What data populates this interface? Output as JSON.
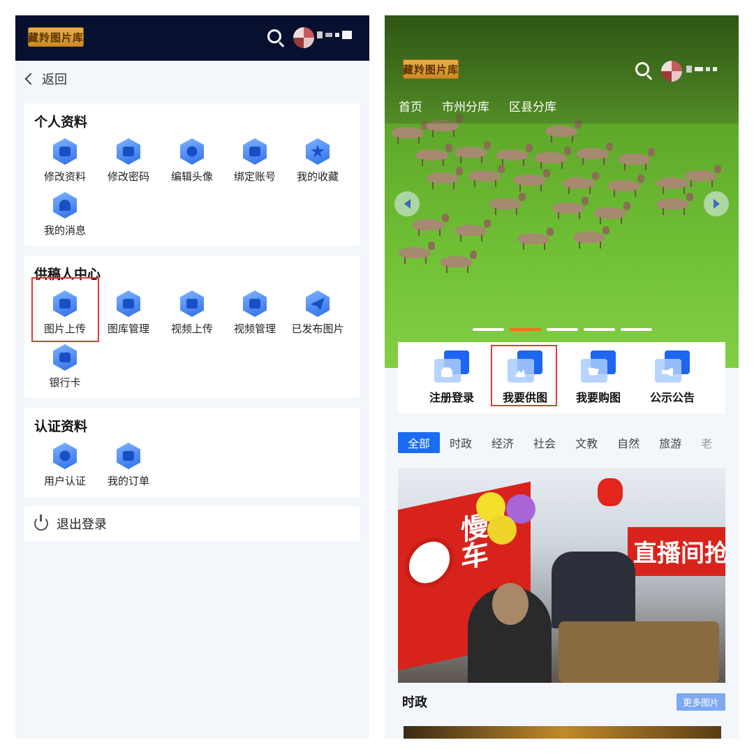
{
  "left": {
    "header": {
      "logo_text": "藏羚图片库"
    },
    "back_label": "返回",
    "profile": {
      "title": "个人资料",
      "items": [
        {
          "label": "修改资料",
          "icon": "edit-profile-icon"
        },
        {
          "label": "修改密码",
          "icon": "lock-icon"
        },
        {
          "label": "编辑头像",
          "icon": "user-avatar-icon"
        },
        {
          "label": "绑定账号",
          "icon": "link-icon"
        },
        {
          "label": "我的收藏",
          "icon": "star-icon"
        },
        {
          "label": "我的消息",
          "icon": "bell-icon"
        }
      ]
    },
    "contributor": {
      "title": "供稿人中心",
      "items": [
        {
          "label": "图片上传",
          "icon": "image-upload-icon"
        },
        {
          "label": "图库管理",
          "icon": "gallery-manage-icon"
        },
        {
          "label": "视频上传",
          "icon": "video-upload-icon"
        },
        {
          "label": "视频管理",
          "icon": "video-manage-icon"
        },
        {
          "label": "已发布图片",
          "icon": "paper-plane-icon"
        },
        {
          "label": "银行卡",
          "icon": "bank-card-icon"
        }
      ]
    },
    "certification": {
      "title": "认证资料",
      "items": [
        {
          "label": "用户认证",
          "icon": "user-verify-icon"
        },
        {
          "label": "我的订单",
          "icon": "order-list-icon"
        }
      ]
    },
    "logout_label": "退出登录"
  },
  "right": {
    "header": {
      "logo_text": "藏羚图片库"
    },
    "nav": [
      "首页",
      "市州分库",
      "区县分库"
    ],
    "carousel": {
      "slide_count": 5,
      "active_index": 1
    },
    "quick_actions": [
      {
        "label": "注册登录",
        "icon": "register-login-icon"
      },
      {
        "label": "我要供图",
        "icon": "supply-image-icon"
      },
      {
        "label": "我要购图",
        "icon": "buy-image-icon"
      },
      {
        "label": "公示公告",
        "icon": "announcement-icon"
      }
    ],
    "tabs": [
      "全部",
      "时政",
      "经济",
      "社会",
      "文教",
      "自然",
      "旅游",
      "老"
    ],
    "active_tab": 0,
    "photo_text": {
      "banner_left": "慢火车",
      "banner_right": "直播间抢购"
    },
    "section": {
      "title": "时政",
      "more_label": "更多图片"
    }
  },
  "colors": {
    "header_bg": "#081030",
    "accent": "#1a6cf0",
    "highlight": "#e53935",
    "carousel_active": "#ff6a1a"
  }
}
